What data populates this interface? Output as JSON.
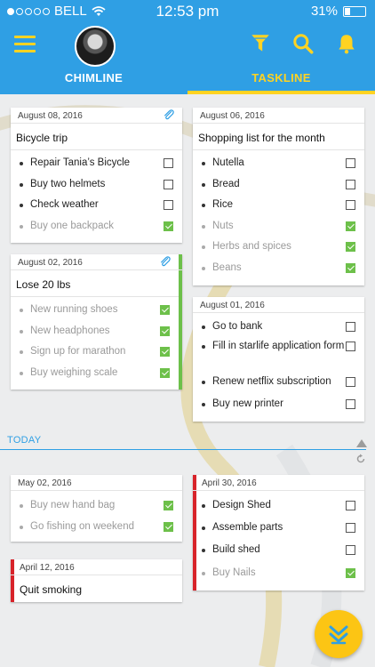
{
  "status_bar": {
    "carrier": "BELL",
    "time": "12:53 pm",
    "battery": "31%"
  },
  "header": {
    "tabs": [
      {
        "label": "CHIMLINE",
        "active": false
      },
      {
        "label": "TASKLINE",
        "active": true
      }
    ]
  },
  "colors": {
    "header_blue": "#2f9fe4",
    "accent_yellow": "#ffd322",
    "done_green": "#6dc04a",
    "priority_red": "#d8232a"
  },
  "cards": {
    "bicycle": {
      "date": "August 08, 2016",
      "title": "Bicycle trip",
      "attachment": true,
      "items": [
        {
          "text": "Repair Tania’s Bicycle",
          "done": false
        },
        {
          "text": "Buy two helmets",
          "done": false
        },
        {
          "text": "Check weather",
          "done": false
        },
        {
          "text": "Buy one backpack",
          "done": true
        }
      ]
    },
    "shopping": {
      "date": "August 06, 2016",
      "title": "Shopping list for the month",
      "items": [
        {
          "text": "Nutella",
          "done": false
        },
        {
          "text": "Bread",
          "done": false
        },
        {
          "text": "Rice",
          "done": false
        },
        {
          "text": "Nuts",
          "done": true
        },
        {
          "text": "Herbs and spices",
          "done": true
        },
        {
          "text": "Beans",
          "done": true
        }
      ]
    },
    "lose": {
      "date": "August 02, 2016",
      "title": "Lose 20 lbs",
      "attachment": true,
      "items": [
        {
          "text": "New running shoes",
          "done": true
        },
        {
          "text": "New headphones",
          "done": true
        },
        {
          "text": "Sign up for marathon",
          "done": true
        },
        {
          "text": "Buy weighing scale",
          "done": true
        }
      ]
    },
    "aug01": {
      "date": "August 01, 2016",
      "items": [
        {
          "text": "Go to bank",
          "done": false
        },
        {
          "text": "Fill in starlife application form",
          "done": false
        },
        {
          "text": "Renew netflix subscription",
          "done": false
        },
        {
          "text": "Buy new printer",
          "done": false
        }
      ]
    },
    "may02": {
      "date": "May 02, 2016",
      "items": [
        {
          "text": "Buy new hand bag",
          "done": true
        },
        {
          "text": "Go fishing on weekend",
          "done": true
        }
      ]
    },
    "apr30": {
      "date": "April 30, 2016",
      "items": [
        {
          "text": "Design Shed",
          "done": false
        },
        {
          "text": "Assemble parts",
          "done": false
        },
        {
          "text": "Build shed",
          "done": false
        },
        {
          "text": "Buy Nails",
          "done": true
        }
      ]
    },
    "apr12": {
      "date": "April 12, 2016",
      "title": "Quit smoking"
    }
  },
  "divider": {
    "label": "TODAY"
  },
  "icons": [
    "menu-icon",
    "avatar",
    "filter-icon",
    "search-icon",
    "bell-icon",
    "paperclip-icon",
    "scroll-up-icon",
    "refresh-icon",
    "double-chevron-down-icon"
  ]
}
